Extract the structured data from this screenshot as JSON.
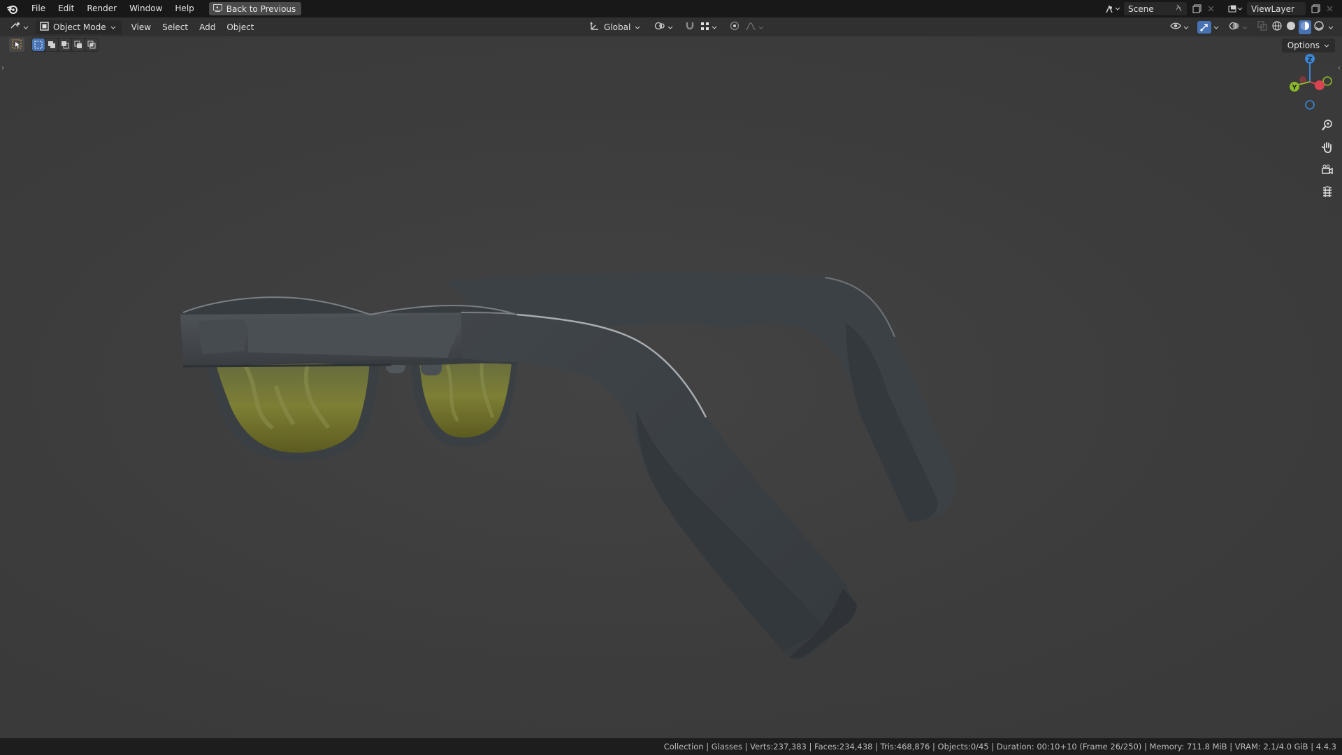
{
  "topbar": {
    "menu": [
      "File",
      "Edit",
      "Render",
      "Window",
      "Help"
    ],
    "back_button": "Back to Previous",
    "scene": "Scene",
    "view_layer": "ViewLayer"
  },
  "header": {
    "mode": "Object Mode",
    "menus": [
      "View",
      "Select",
      "Add",
      "Object"
    ],
    "transform_orientation": "Global"
  },
  "viewport": {
    "options_label": "Options",
    "gizmo": {
      "z": "Z",
      "y": "Y"
    }
  },
  "statusbar": {
    "stats": "Collection | Glasses | Verts:237,383 | Faces:234,438 | Tris:468,876 | Objects:0/45 | Duration: 00:10+10 (Frame 26/250) | Memory: 711.8 MiB | VRAM: 2.1/4.0 GiB | 4.4.3"
  },
  "colors": {
    "axis_x": "#d94452",
    "axis_y": "#8ab82a",
    "axis_z": "#3b86d6",
    "accent": "#4772b3"
  },
  "icons": {
    "app": "blender-logo-icon",
    "back": "back-screen-icon",
    "zoom": "zoom-icon",
    "pan": "hand-icon",
    "camera": "camera-icon",
    "ortho": "grid-icon"
  }
}
